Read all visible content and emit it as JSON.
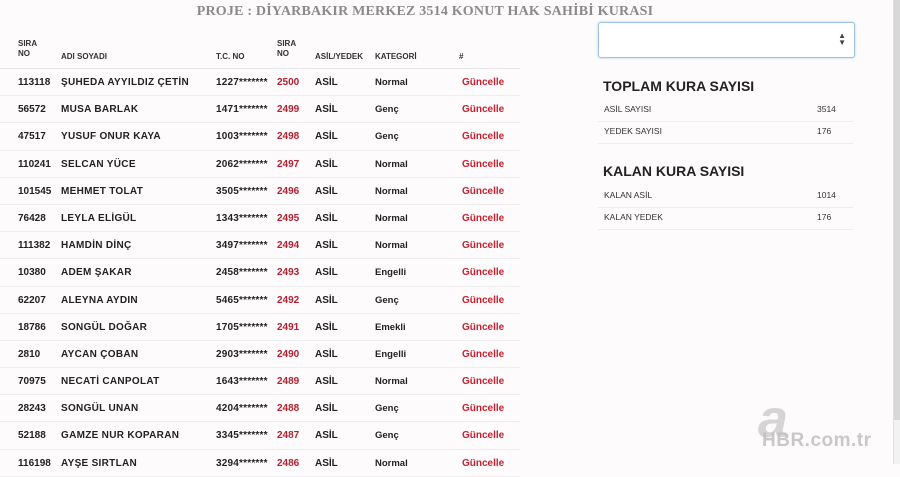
{
  "title": "PROJE : DİYARBAKIR MERKEZ 3514 KONUT HAK SAHİBİ KURASI",
  "table": {
    "headers": {
      "sira_no": "SIRA NO",
      "adi_soyadi": "ADI SOYADI",
      "tc_no": "T.C. NO",
      "sira_no2": "SIRA NO",
      "asil_yedek": "ASİL/YEDEK",
      "kategori": "KATEGORİ",
      "hash": "#"
    },
    "rows": [
      {
        "sira": "113118",
        "name": "ŞUHEDA AYYILDIZ ÇETİN",
        "tc": "1227*******",
        "no": "2500",
        "asil": "ASİL",
        "kategori": "Normal",
        "action": "Güncelle"
      },
      {
        "sira": "56572",
        "name": "MUSA BARLAK",
        "tc": "1471*******",
        "no": "2499",
        "asil": "ASİL",
        "kategori": "Genç",
        "action": "Güncelle"
      },
      {
        "sira": "47517",
        "name": "YUSUF ONUR KAYA",
        "tc": "1003*******",
        "no": "2498",
        "asil": "ASİL",
        "kategori": "Genç",
        "action": "Güncelle"
      },
      {
        "sira": "110241",
        "name": "SELCAN YÜCE",
        "tc": "2062*******",
        "no": "2497",
        "asil": "ASİL",
        "kategori": "Normal",
        "action": "Güncelle"
      },
      {
        "sira": "101545",
        "name": "MEHMET TOLAT",
        "tc": "3505*******",
        "no": "2496",
        "asil": "ASİL",
        "kategori": "Normal",
        "action": "Güncelle"
      },
      {
        "sira": "76428",
        "name": "LEYLA ELİGÜL",
        "tc": "1343*******",
        "no": "2495",
        "asil": "ASİL",
        "kategori": "Normal",
        "action": "Güncelle"
      },
      {
        "sira": "111382",
        "name": "HAMDİN DİNÇ",
        "tc": "3497*******",
        "no": "2494",
        "asil": "ASİL",
        "kategori": "Normal",
        "action": "Güncelle"
      },
      {
        "sira": "10380",
        "name": "ADEM ŞAKAR",
        "tc": "2458*******",
        "no": "2493",
        "asil": "ASİL",
        "kategori": "Engelli",
        "action": "Güncelle"
      },
      {
        "sira": "62207",
        "name": "ALEYNA AYDIN",
        "tc": "5465*******",
        "no": "2492",
        "asil": "ASİL",
        "kategori": "Genç",
        "action": "Güncelle"
      },
      {
        "sira": "18786",
        "name": "SONGÜL DOĞAR",
        "tc": "1705*******",
        "no": "2491",
        "asil": "ASİL",
        "kategori": "Emekli",
        "action": "Güncelle"
      },
      {
        "sira": "2810",
        "name": "AYCAN ÇOBAN",
        "tc": "2903*******",
        "no": "2490",
        "asil": "ASİL",
        "kategori": "Engelli",
        "action": "Güncelle"
      },
      {
        "sira": "70975",
        "name": "NECATİ CANPOLAT",
        "tc": "1643*******",
        "no": "2489",
        "asil": "ASİL",
        "kategori": "Normal",
        "action": "Güncelle"
      },
      {
        "sira": "28243",
        "name": "SONGÜL UNAN",
        "tc": "4204*******",
        "no": "2488",
        "asil": "ASİL",
        "kategori": "Genç",
        "action": "Güncelle"
      },
      {
        "sira": "52188",
        "name": "GAMZE NUR KOPARAN",
        "tc": "3345*******",
        "no": "2487",
        "asil": "ASİL",
        "kategori": "Genç",
        "action": "Güncelle"
      },
      {
        "sira": "116198",
        "name": "AYŞE SIRTLAN",
        "tc": "3294*******",
        "no": "2486",
        "asil": "ASİL",
        "kategori": "Normal",
        "action": "Güncelle"
      }
    ]
  },
  "select": {
    "value": ""
  },
  "toplam": {
    "title": "TOPLAM KURA SAYISI",
    "asil_label": "ASİL SAYISI",
    "asil_value": "3514",
    "yedek_label": "YEDEK SAYISI",
    "yedek_value": "176"
  },
  "kalan": {
    "title": "KALAN KURA SAYISI",
    "asil_label": "KALAN ASİL",
    "asil_value": "1014",
    "yedek_label": "KALAN YEDEK",
    "yedek_value": "176"
  },
  "watermark": {
    "text": "HBR.com.tr",
    "logo_letter": "a"
  },
  "colors": {
    "link": "#c8202f",
    "sira_no": "#b51f2e",
    "title": "#8a8a8a"
  }
}
